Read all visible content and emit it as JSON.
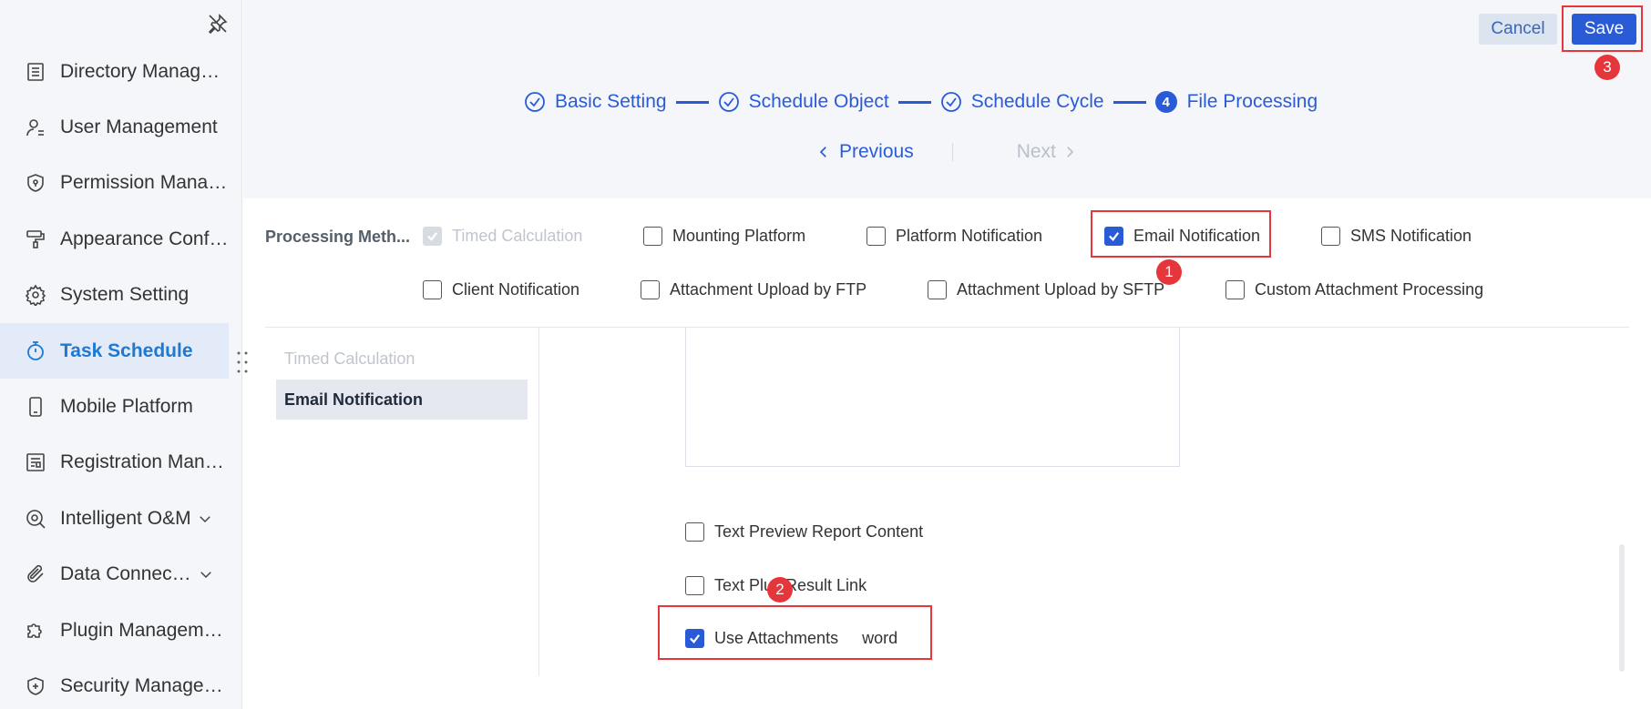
{
  "sidebar": {
    "items": [
      {
        "label": "Directory Management",
        "icon": "list-icon"
      },
      {
        "label": "User Management",
        "icon": "user-icon"
      },
      {
        "label": "Permission Management",
        "icon": "shield-lock-icon"
      },
      {
        "label": "Appearance Configuration",
        "icon": "paint-roller-icon"
      },
      {
        "label": "System Setting",
        "icon": "gear-icon"
      },
      {
        "label": "Task Schedule",
        "icon": "stopwatch-icon"
      },
      {
        "label": "Mobile Platform",
        "icon": "mobile-icon"
      },
      {
        "label": "Registration Management",
        "icon": "registration-icon"
      },
      {
        "label": "Intelligent O&M",
        "icon": "om-icon"
      },
      {
        "label": "Data Connection",
        "icon": "paperclip-icon"
      },
      {
        "label": "Plugin Management",
        "icon": "puzzle-icon"
      },
      {
        "label": "Security Management",
        "icon": "shield-plus-icon"
      }
    ]
  },
  "header": {
    "cancel_label": "Cancel",
    "save_label": "Save"
  },
  "steps": [
    {
      "label": "Basic Setting"
    },
    {
      "label": "Schedule Object"
    },
    {
      "label": "Schedule Cycle"
    },
    {
      "label": "File Processing",
      "number": "4"
    }
  ],
  "pager": {
    "previous": "Previous",
    "next": "Next"
  },
  "processing": {
    "label": "Processing Meth...",
    "options": [
      {
        "label": "Timed Calculation"
      },
      {
        "label": "Mounting Platform"
      },
      {
        "label": "Platform Notification"
      },
      {
        "label": "Email Notification"
      },
      {
        "label": "SMS Notification"
      },
      {
        "label": "Client Notification"
      },
      {
        "label": "Attachment Upload by FTP"
      },
      {
        "label": "Attachment Upload by SFTP"
      },
      {
        "label": "Custom Attachment Processing"
      }
    ]
  },
  "sublist": {
    "items": [
      "Timed Calculation",
      "Email Notification"
    ]
  },
  "email_options": {
    "text_preview": "Text Preview Report Content",
    "text_plus": "Text Plus Result Link",
    "use_attachments": "Use Attachments",
    "attachment_format": "word"
  },
  "annotations": {
    "one": "1",
    "two": "2",
    "three": "3"
  },
  "colors": {
    "accent": "#2a5bd7",
    "highlight": "#e5363b",
    "active_nav": "#1f78d1"
  }
}
